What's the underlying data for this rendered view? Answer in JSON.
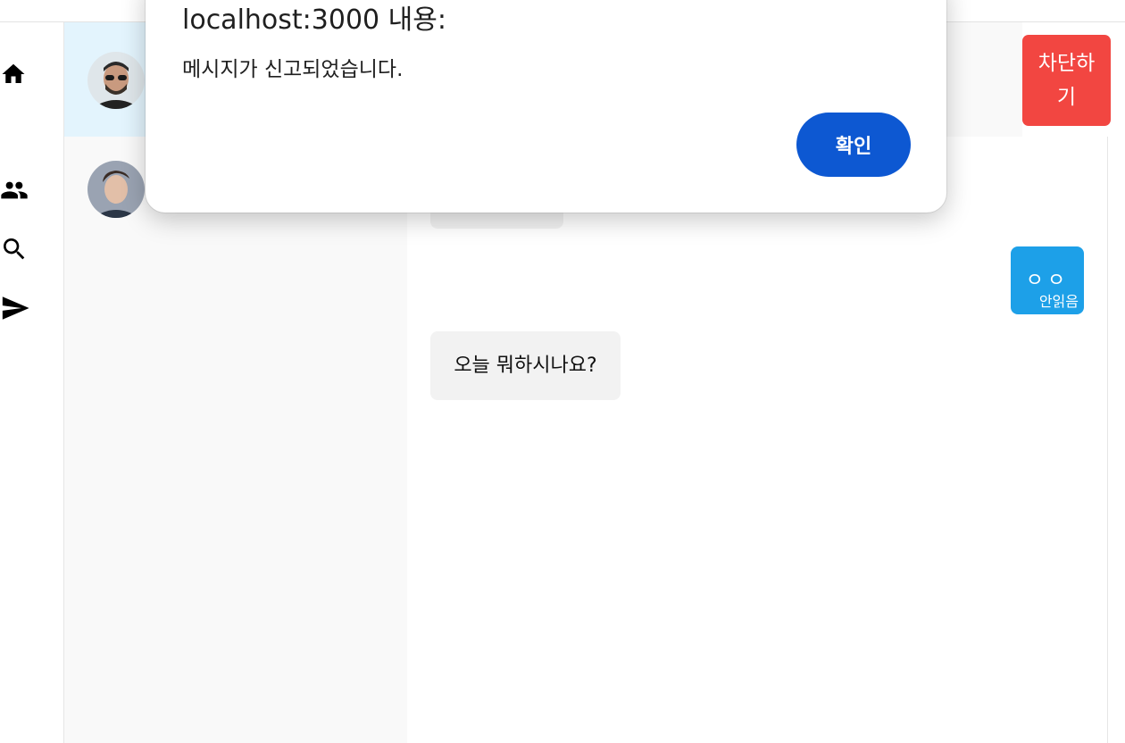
{
  "nav": {
    "icons": [
      "home-icon",
      "people-icon",
      "search-icon",
      "send-icon"
    ]
  },
  "chat_list": {
    "rows": [
      {
        "avatar": "avatar-man-sunglasses",
        "active": true
      },
      {
        "avatar": "avatar-man-portrait",
        "active": false
      }
    ]
  },
  "conversation": {
    "block_button_label": "차단하기",
    "messages": [
      {
        "side": "mine",
        "text": "ㅇㅇ",
        "status": "안읽음"
      },
      {
        "side": "theirs",
        "text": "오늘 뭐하시나요?"
      }
    ]
  },
  "dialog": {
    "title": "localhost:3000 내용:",
    "message": "메시지가 신고되었습니다.",
    "ok_label": "확인"
  },
  "colors": {
    "accent_blue": "#1da0e8",
    "active_row": "#e3f4fd",
    "danger": "#f24641",
    "dialog_button": "#0d58d2",
    "bubble_gray": "#f2f2f2"
  }
}
